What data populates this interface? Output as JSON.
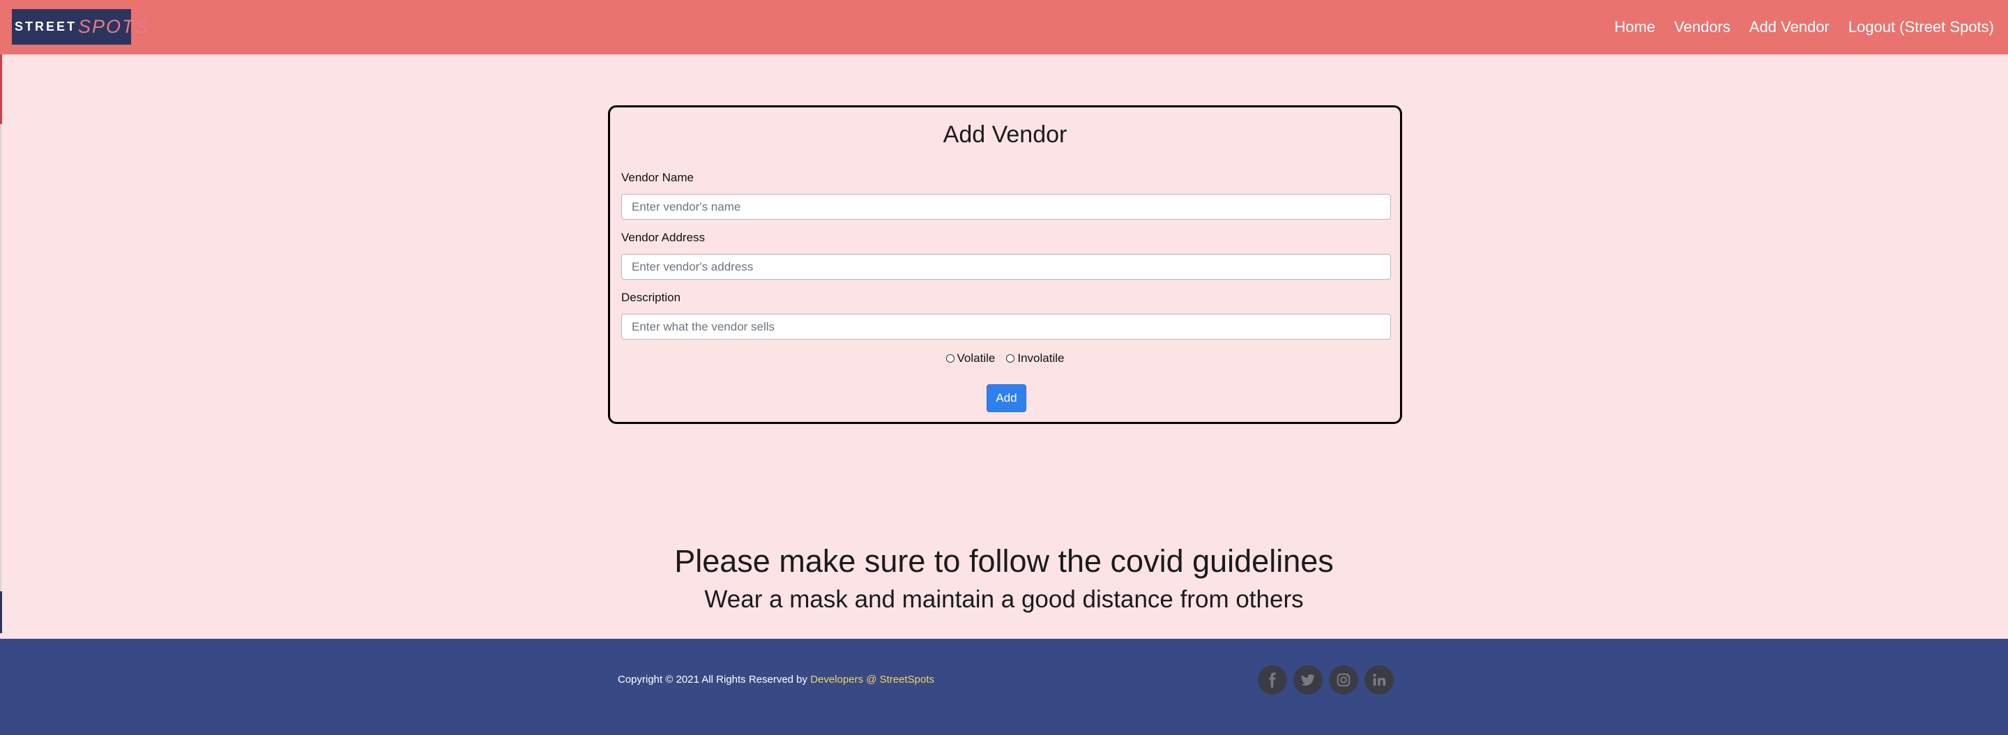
{
  "brand": {
    "part1": "STREET",
    "part2": "SPOTS"
  },
  "nav": {
    "links": [
      {
        "label": "Home"
      },
      {
        "label": "Vendors"
      },
      {
        "label": "Add Vendor"
      },
      {
        "label": "Logout (Street Spots)"
      }
    ]
  },
  "form": {
    "title": "Add Vendor",
    "name": {
      "label": "Vendor Name",
      "placeholder": "Enter vendor's name",
      "value": ""
    },
    "address": {
      "label": "Vendor Address",
      "placeholder": "Enter vendor's address",
      "value": ""
    },
    "description": {
      "label": "Description",
      "placeholder": "Enter what the vendor sells",
      "value": ""
    },
    "options": [
      {
        "label": "Volatile"
      },
      {
        "label": "Involatile"
      }
    ],
    "submit_label": "Add"
  },
  "notice": {
    "title": "Please make sure to follow the covid guidelines",
    "subtitle": "Wear a mask and maintain a good distance from others"
  },
  "footer": {
    "copyright": "Copyright © 2021 All Rights Reserved by ",
    "link": "Developers @ StreetSpots",
    "socials": [
      "facebook-icon",
      "twitter-icon",
      "instagram-icon",
      "linkedin-icon"
    ]
  },
  "colors": {
    "navbar": "#e9736f",
    "page_bg": "#fce3e5",
    "footer": "#384a85",
    "button": "#2f80ed",
    "link": "#f4d35e"
  }
}
